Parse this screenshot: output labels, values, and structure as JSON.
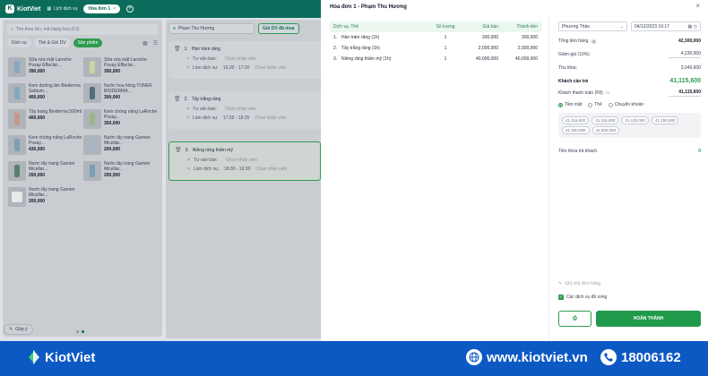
{
  "app": {
    "brand": "KiotViet",
    "history_label": "Lịch dịch vụ",
    "active_tab": "Hóa đơn 1"
  },
  "products_panel": {
    "search_placeholder": "Tìm theo tên, mã hàng hóa (F3)",
    "filters": [
      "Dịch vụ",
      "Thẻ & Gói DV",
      "Sản phẩm"
    ],
    "items": [
      {
        "name": "Sữa rửa mặt Laroche Posay Effaclar...",
        "price": "390,000"
      },
      {
        "name": "Sữa rửa mặt Laroche Posay Effaclar...",
        "price": "390,000"
      },
      {
        "name": "Kem dưỡng ẩm Bioderma Sebium...",
        "price": "400,000"
      },
      {
        "name": "Nước hoa hồng TONER BIODERMA...",
        "price": "300,000"
      },
      {
        "name": "Tẩy trang Bioderma 500ml",
        "price": "400,000"
      },
      {
        "name": "Kem chống nắng LaRoche Posay...",
        "price": "350,000"
      },
      {
        "name": "Kem chống nắng LaRoche Posay...",
        "price": "430,000"
      },
      {
        "name": "Nước tẩy trang Garnier Micellar...",
        "price": "200,000"
      },
      {
        "name": "Nước tẩy trang Garnier Micellar...",
        "price": "200,000"
      },
      {
        "name": "Nước tẩy trang Garnier Micellar...",
        "price": "200,000"
      },
      {
        "name": "Nước tẩy trang Garnier Micellar...",
        "price": "200,000"
      }
    ],
    "feedback_label": "Góp ý"
  },
  "services_panel": {
    "customer": "Phạm Thu Hương",
    "package_button": "Gói DV đã mua",
    "staff_placeholder": "Chọn nhân viên",
    "consultant_label": "Tư vấn bán:",
    "doer_label": "Làm dịch vụ:",
    "cards": [
      {
        "index": "1.",
        "name": "Hàn trám răng",
        "time": "16:20 - 17:20"
      },
      {
        "index": "2.",
        "name": "Tẩy trắng răng",
        "time": "17:25 - 18:25"
      },
      {
        "index": "3.",
        "name": "Niềng răng thẩm mỹ",
        "time": "18:30 - 19:30"
      }
    ]
  },
  "invoice_modal": {
    "title": "Hóa đơn 1 - Phạm Thu Hương",
    "columns": [
      "Dịch vụ, Thẻ",
      "Số lượng",
      "Giá bán",
      "Thành tiền"
    ],
    "rows": [
      {
        "index": "1.",
        "name": "Hàn trám răng (1h)",
        "qty": "1",
        "price": "300,000",
        "total": "300,000"
      },
      {
        "index": "2.",
        "name": "Tẩy trắng răng (1h)",
        "qty": "1",
        "price": "2,000,000",
        "total": "2,000,000"
      },
      {
        "index": "3.",
        "name": "Niềng răng thẩm mỹ (1h)",
        "qty": "1",
        "price": "40,000,000",
        "total": "40,000,000"
      }
    ],
    "staff_select": "Phương Thảo",
    "date": "04/12/2023 16:17",
    "total_label": "Tổng tiền hàng",
    "total_count": "2",
    "total_value": "42,300,000",
    "discount_label": "Giảm giá (10%)",
    "discount_value": "4,230,000",
    "other_label": "Thu khác",
    "other_value": "3,045,600",
    "due_label": "Khách cần trả",
    "due_value": "41,115,600",
    "paid_label": "Khách thanh toán (F8)",
    "paid_value": "41,115,600",
    "payment_methods": [
      "Tiền mặt",
      "Thẻ",
      "Chuyển khoản"
    ],
    "quick_amounts": [
      "41,115,600",
      "41,116,000",
      "41,120,000",
      "41,150,000",
      "41,200,000",
      "41,500,000"
    ],
    "change_label": "Tiền thừa trả khách",
    "change_value": "0",
    "note_placeholder": "Ghi chú đơn hàng",
    "done_check_label": "Các dịch vụ đã xong",
    "print_button": "⎙",
    "complete_button": "HOÀN THÀNH"
  },
  "footer": {
    "brand": "KiotViet",
    "website": "www.kiotviet.vn",
    "phone": "18006162"
  },
  "colors": {
    "brand_green": "#0b6c5c",
    "accent_green": "#2e9b4f",
    "footer_blue": "#0d59c4"
  }
}
